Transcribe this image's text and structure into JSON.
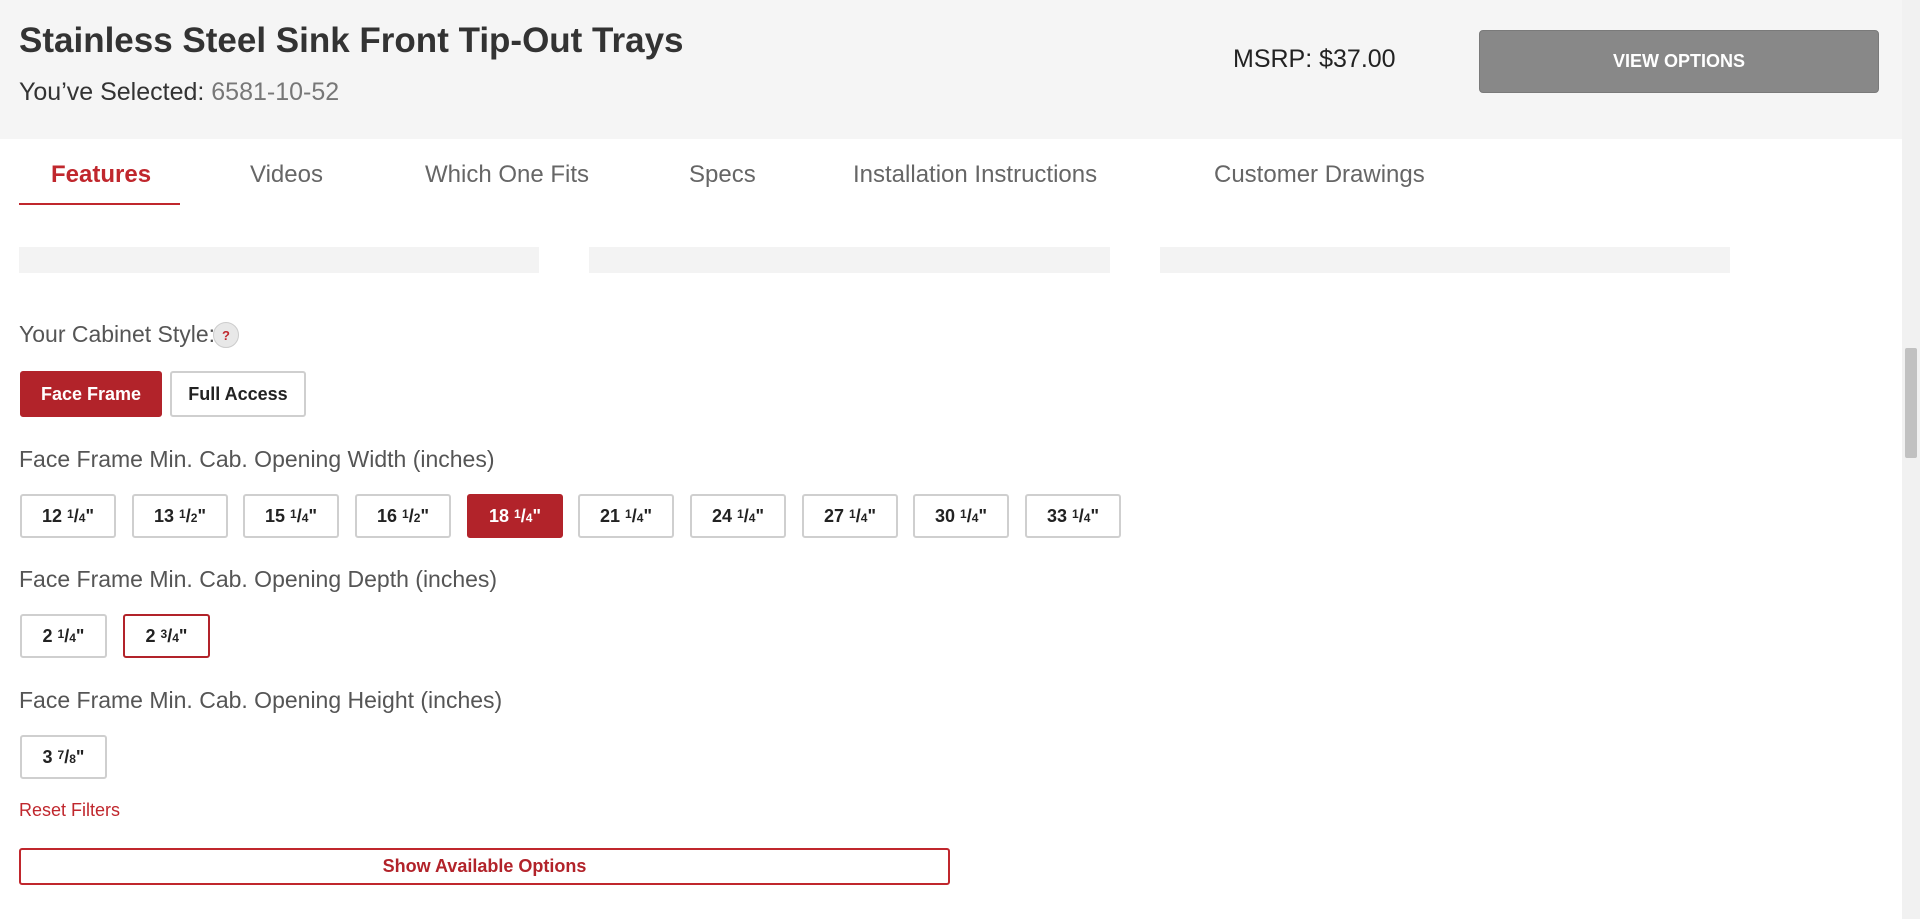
{
  "header": {
    "title": "Stainless Steel Sink Front Tip-Out Trays",
    "selected_label": "You’ve Selected:",
    "selected_sku": "6581-10-52",
    "msrp": "MSRP: $37.00",
    "view_options_label": "VIEW OPTIONS"
  },
  "tabs": [
    {
      "label": "Features",
      "active": true
    },
    {
      "label": "Videos",
      "active": false
    },
    {
      "label": "Which One Fits",
      "active": false
    },
    {
      "label": "Specs",
      "active": false
    },
    {
      "label": "Installation Instructions",
      "active": false
    },
    {
      "label": "Customer Drawings",
      "active": false
    }
  ],
  "cabinet_style": {
    "label": "Your Cabinet Style:",
    "help_label": "?",
    "options": [
      {
        "label": "Face Frame",
        "selected": true
      },
      {
        "label": "Full Access",
        "selected": false
      }
    ]
  },
  "width": {
    "label": "Face Frame Min. Cab. Opening Width (inches)",
    "options": [
      {
        "whole": "12",
        "num": "1",
        "den": "4",
        "selected": false
      },
      {
        "whole": "13",
        "num": "1",
        "den": "2",
        "selected": false
      },
      {
        "whole": "15",
        "num": "1",
        "den": "4",
        "selected": false
      },
      {
        "whole": "16",
        "num": "1",
        "den": "2",
        "selected": false
      },
      {
        "whole": "18",
        "num": "1",
        "den": "4",
        "selected": true
      },
      {
        "whole": "21",
        "num": "1",
        "den": "4",
        "selected": false
      },
      {
        "whole": "24",
        "num": "1",
        "den": "4",
        "selected": false
      },
      {
        "whole": "27",
        "num": "1",
        "den": "4",
        "selected": false
      },
      {
        "whole": "30",
        "num": "1",
        "den": "4",
        "selected": false
      },
      {
        "whole": "33",
        "num": "1",
        "den": "4",
        "selected": false
      }
    ]
  },
  "depth": {
    "label": "Face Frame Min. Cab. Opening Depth (inches)",
    "options": [
      {
        "whole": "2",
        "num": "1",
        "den": "4",
        "selected": false
      },
      {
        "whole": "2",
        "num": "3",
        "den": "4",
        "selected": false,
        "outlined": true
      }
    ]
  },
  "height": {
    "label": "Face Frame Min. Cab. Opening Height (inches)",
    "options": [
      {
        "whole": "3",
        "num": "7",
        "den": "8",
        "selected": false
      }
    ]
  },
  "reset_label": "Reset Filters",
  "show_options_label": "Show Available Options",
  "colors": {
    "accent": "#b2232a",
    "header_bg": "#f5f5f5",
    "view_button": "#888888"
  }
}
